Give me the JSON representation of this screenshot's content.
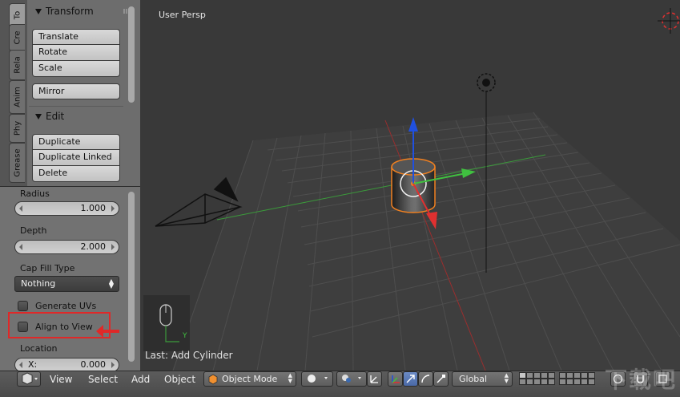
{
  "tabs": [
    "To",
    "Cre",
    "Rela",
    "Anim",
    "Phy",
    "Grease"
  ],
  "transform_panel": {
    "title": "Transform",
    "buttons": [
      "Translate",
      "Rotate",
      "Scale"
    ],
    "mirror": "Mirror"
  },
  "edit_panel": {
    "title": "Edit",
    "buttons": [
      "Duplicate",
      "Duplicate Linked",
      "Delete"
    ]
  },
  "operator": {
    "radius_label": "Radius",
    "radius_value": "1.000",
    "depth_label": "Depth",
    "depth_value": "2.000",
    "cap_fill_label": "Cap Fill Type",
    "cap_fill_value": "Nothing",
    "generate_uvs": "Generate UVs",
    "generate_uvs_checked": false,
    "align_to_view": "Align to View",
    "align_to_view_checked": false,
    "location_label": "Location",
    "location_x_label": "X:",
    "location_x_value": "0.000"
  },
  "viewport": {
    "view_label": "User Persp",
    "last_operation": "Last: Add Cylinder",
    "gizmo_axis_y": "Y"
  },
  "header": {
    "menus": [
      "View",
      "Select",
      "Add",
      "Object"
    ],
    "mode": "Object Mode",
    "orientation": "Global"
  },
  "watermark": "下载吧",
  "colors": {
    "x_axis": "#e03030",
    "y_axis": "#40c040",
    "z_axis": "#2050e0",
    "selection": "#f08020",
    "highlight": "#e02828"
  }
}
